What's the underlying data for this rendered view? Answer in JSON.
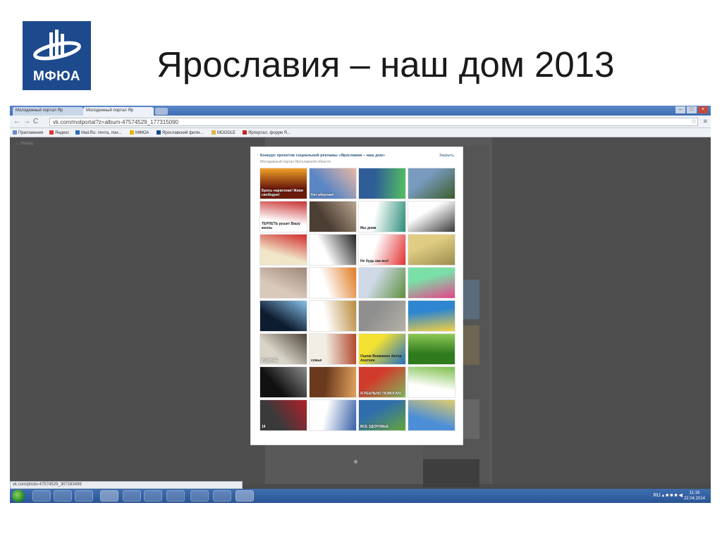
{
  "slide": {
    "logo_text": "МФЮА",
    "title": "Ярославия – наш дом 2013"
  },
  "browser": {
    "tabs": [
      {
        "label": "Молодежный портал Яр"
      },
      {
        "label": "Молодежный портал Яр"
      }
    ],
    "url": "vk.com/molportal?z=album-47574529_177315090",
    "bookmarks": [
      "Приложения",
      "Яндекс",
      "Mail.Ru: почта, пои...",
      "МФЮА",
      "Ярославский фили...",
      "MOODLE",
      "Ярпортал, форум Я..."
    ],
    "status_url": "vk.com/photo-47574529_307183499"
  },
  "page": {
    "back_link": "← Назад"
  },
  "modal": {
    "title": "Конкурс проектов социальной рекламы «Ярославия – наш дом»",
    "subtitle": "Молодежный портал Ярославской области",
    "close_label": "Закрыть",
    "photos": [
      {
        "caption": "Брось наркотики! Живи свободно!",
        "colors": [
          "#6b1b0c",
          "#f2a12a"
        ]
      },
      {
        "caption": "Нет абортам!",
        "colors": [
          "#5b86c5",
          "#e8b9a4"
        ]
      },
      {
        "caption": "",
        "colors": [
          "#2f5e97",
          "#54c15f"
        ]
      },
      {
        "caption": "",
        "colors": [
          "#789bbe",
          "#3d5c2b"
        ]
      },
      {
        "caption": "ТЕРПЕТЬ рушит Вашу жизнь",
        "colors": [
          "#ffffff",
          "#c83232"
        ]
      },
      {
        "caption": "",
        "colors": [
          "#4b3e33",
          "#b9a48e"
        ]
      },
      {
        "caption": "Мы дома",
        "colors": [
          "#ffffff",
          "#2f8f7b"
        ]
      },
      {
        "caption": "",
        "colors": [
          "#ffffff",
          "#3a3a3a"
        ]
      },
      {
        "caption": "",
        "colors": [
          "#f0e6c8",
          "#d12b2b"
        ]
      },
      {
        "caption": "",
        "colors": [
          "#ffffff",
          "#222222"
        ]
      },
      {
        "caption": "Не будь как все!",
        "colors": [
          "#ffffff",
          "#e23232"
        ]
      },
      {
        "caption": "",
        "colors": [
          "#e0cd83",
          "#9b8d4d"
        ]
      },
      {
        "caption": "",
        "colors": [
          "#d8c9bb",
          "#a0877a"
        ]
      },
      {
        "caption": "",
        "colors": [
          "#ffffff",
          "#e07a20"
        ]
      },
      {
        "caption": "",
        "colors": [
          "#cfd9e6",
          "#5d8f3e"
        ]
      },
      {
        "caption": "",
        "colors": [
          "#7ae0a8",
          "#e8438b"
        ]
      },
      {
        "caption": "",
        "colors": [
          "#0e1c30",
          "#88c2ea"
        ]
      },
      {
        "caption": "",
        "colors": [
          "#ffffff",
          "#b88a3c"
        ]
      },
      {
        "caption": "",
        "colors": [
          "#8f8f8f",
          "#b5b1a6"
        ]
      },
      {
        "caption": "",
        "colors": [
          "#2e86d1",
          "#f3d040"
        ]
      },
      {
        "caption": "РОДНЫЕ",
        "colors": [
          "#d9d4c8",
          "#4d4538"
        ]
      },
      {
        "caption": "семья",
        "colors": [
          "#f2eee4",
          "#b1472a"
        ]
      },
      {
        "caption": "Оцени Внимание Автор Ахатхин",
        "colors": [
          "#f4e233",
          "#1f6ec0"
        ]
      },
      {
        "caption": "",
        "colors": [
          "#2f7a1f",
          "#8fca56"
        ]
      },
      {
        "caption": "",
        "colors": [
          "#111111",
          "#8a8a8a"
        ]
      },
      {
        "caption": "",
        "colors": [
          "#6b3a1e",
          "#e2a35d"
        ]
      },
      {
        "caption": "Я РЕАЛЬНО ПОМОГАЮ",
        "colors": [
          "#d13b2c",
          "#7fb75a"
        ]
      },
      {
        "caption": "",
        "colors": [
          "#ffffff",
          "#7cbf4a"
        ]
      },
      {
        "caption": "18",
        "colors": [
          "#3a3a3a",
          "#b31f2a"
        ]
      },
      {
        "caption": "",
        "colors": [
          "#ffffff",
          "#3760a8"
        ]
      },
      {
        "caption": "ВСЕ ЗДОРОВЬЕ",
        "colors": [
          "#2f6dad",
          "#64a63a"
        ]
      },
      {
        "caption": "",
        "colors": [
          "#4d8fd6",
          "#e0cc6c"
        ]
      }
    ]
  },
  "taskbar": {
    "tray_language": "RU",
    "time": "11:16",
    "date": "22.04.2014"
  }
}
